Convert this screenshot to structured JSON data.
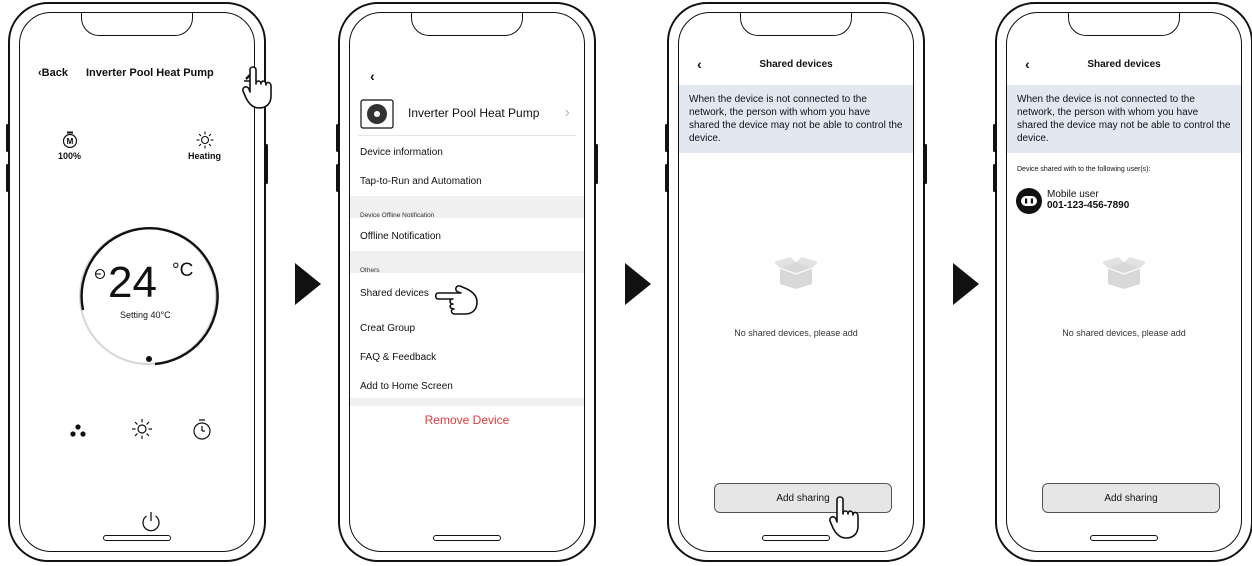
{
  "screens": {
    "control": {
      "back_label": "Back",
      "title": "Inverter Pool Heat Pump",
      "motor_value": "100%",
      "mode_value": "Heating",
      "temperature": "24",
      "temperature_unit": "°C",
      "setting_text": "Setting 40°C",
      "icons": [
        "motor-icon",
        "sun-icon",
        "fan-icon",
        "sun-icon",
        "timer-icon",
        "power-icon",
        "pencil-icon"
      ]
    },
    "settings": {
      "device_name": "Inverter Pool Heat Pump",
      "items": {
        "device_information": "Device information",
        "tap_to_run": "Tap-to-Run and Automation",
        "offline_section": "Device Offline Notification",
        "offline_notification": "Offline Notification",
        "others_section": "Others",
        "shared_devices": "Shared devices",
        "creat_group": "Creat Group",
        "faq": "FAQ & Feedback",
        "add_home": "Add to Home Screen"
      },
      "remove_label": "Remove Device",
      "accent_color": "#e23b3b"
    },
    "shared_empty": {
      "title": "Shared devices",
      "notice": "When the device is not connected to the network, the person with whom you have shared the device may not be able to control the device.",
      "empty_message": "No shared devices, please add",
      "add_button": "Add sharing"
    },
    "shared_list": {
      "title": "Shared devices",
      "notice": "When the device is not connected to the network, the person with whom you have shared the device may not be able to control the device.",
      "shared_with_label": "Device shared with to the following user(s):",
      "user_name": "Mobile user",
      "user_phone": "001-123-456-7890",
      "empty_message": "No shared devices, please add",
      "add_button": "Add sharing"
    }
  },
  "colors": {
    "notice_bg": "#e1e8f2",
    "button_bg": "#e6e6e6"
  }
}
